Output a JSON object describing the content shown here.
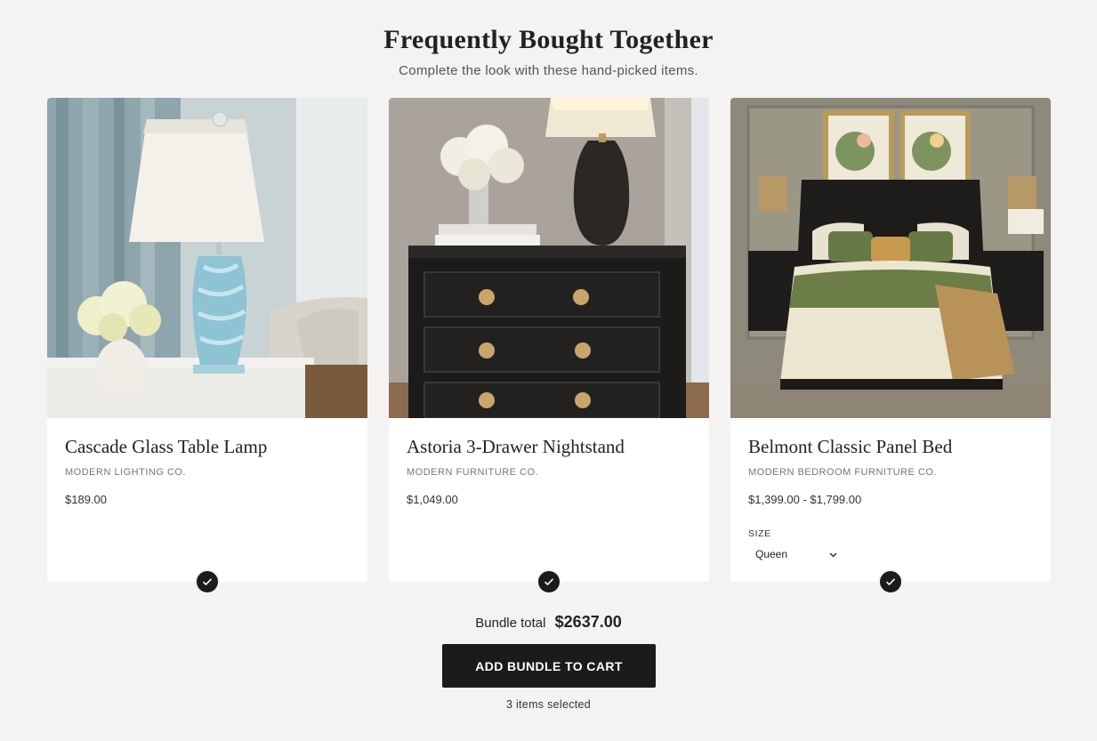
{
  "section": {
    "title": "Frequently Bought Together",
    "subtitle": "Complete the look with these hand-picked items."
  },
  "products": [
    {
      "name": "Cascade Glass Table Lamp",
      "brand": "MODERN LIGHTING CO.",
      "price": "$189.00",
      "image": "glass-table-lamp-photo",
      "selected": true
    },
    {
      "name": "Astoria 3-Drawer Nightstand",
      "brand": "MODERN FURNITURE CO.",
      "price": "$1,049.00",
      "image": "black-nightstand-photo",
      "selected": true
    },
    {
      "name": "Belmont Classic Panel Bed",
      "brand": "MODERN BEDROOM FURNITURE CO.",
      "price": "$1,399.00 - $1,799.00",
      "image": "panel-bed-photo",
      "selected": true,
      "size_label": "SIZE",
      "size_value": "Queen"
    }
  ],
  "bundle": {
    "total_label": "Bundle total",
    "total_value": "$2637.00",
    "button_label": "ADD BUNDLE TO CART",
    "items_selected": "3 items selected"
  },
  "colors": {
    "background": "#f4f3f1",
    "button": "#1b1b1b",
    "check": "#1b1b1b"
  }
}
